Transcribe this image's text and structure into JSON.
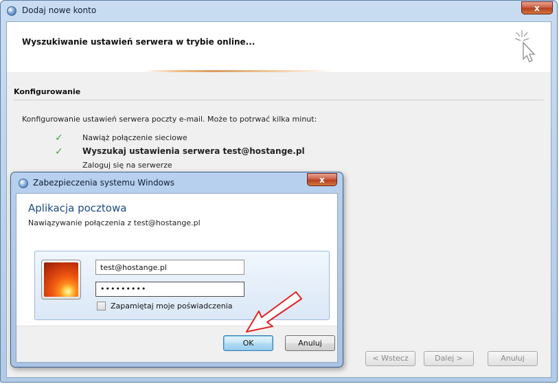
{
  "main_window": {
    "title": "Dodaj nowe konto",
    "close_label": "x",
    "header_title": "Wyszukiwanie ustawień serwera w trybie online...",
    "section_title": "Konfigurowanie",
    "description": "Konfigurowanie ustawień serwera poczty e-mail. Może to potrwać kilka minut:",
    "steps": [
      {
        "label": "Nawiąż połączenie sieciowe",
        "status": "done"
      },
      {
        "label": "Wyszukaj ustawienia serwera test@hostange.pl",
        "status": "done"
      },
      {
        "label": "Zaloguj się na serwerze",
        "status": "pending"
      }
    ],
    "check_glyph": "✓",
    "buttons": {
      "back": "< Wstecz",
      "next": "Dalej >",
      "cancel": "Anuluj"
    }
  },
  "security_dialog": {
    "title": "Zabezpieczenia systemu Windows",
    "close_label": "x",
    "app_title": "Aplikacja pocztowa",
    "subtitle": "Nawiązywanie połączenia z test@hostange.pl",
    "username_value": "test@hostange.pl",
    "password_value": "•••••••••",
    "remember_label": "Zapamiętaj moje poświadczenia",
    "remember_checked": false,
    "ok_label": "OK",
    "cancel_label": "Anuluj"
  },
  "colors": {
    "accent_title": "#1e4a86",
    "check_green": "#3ea33c",
    "annotation_arrow": "#e02020"
  }
}
